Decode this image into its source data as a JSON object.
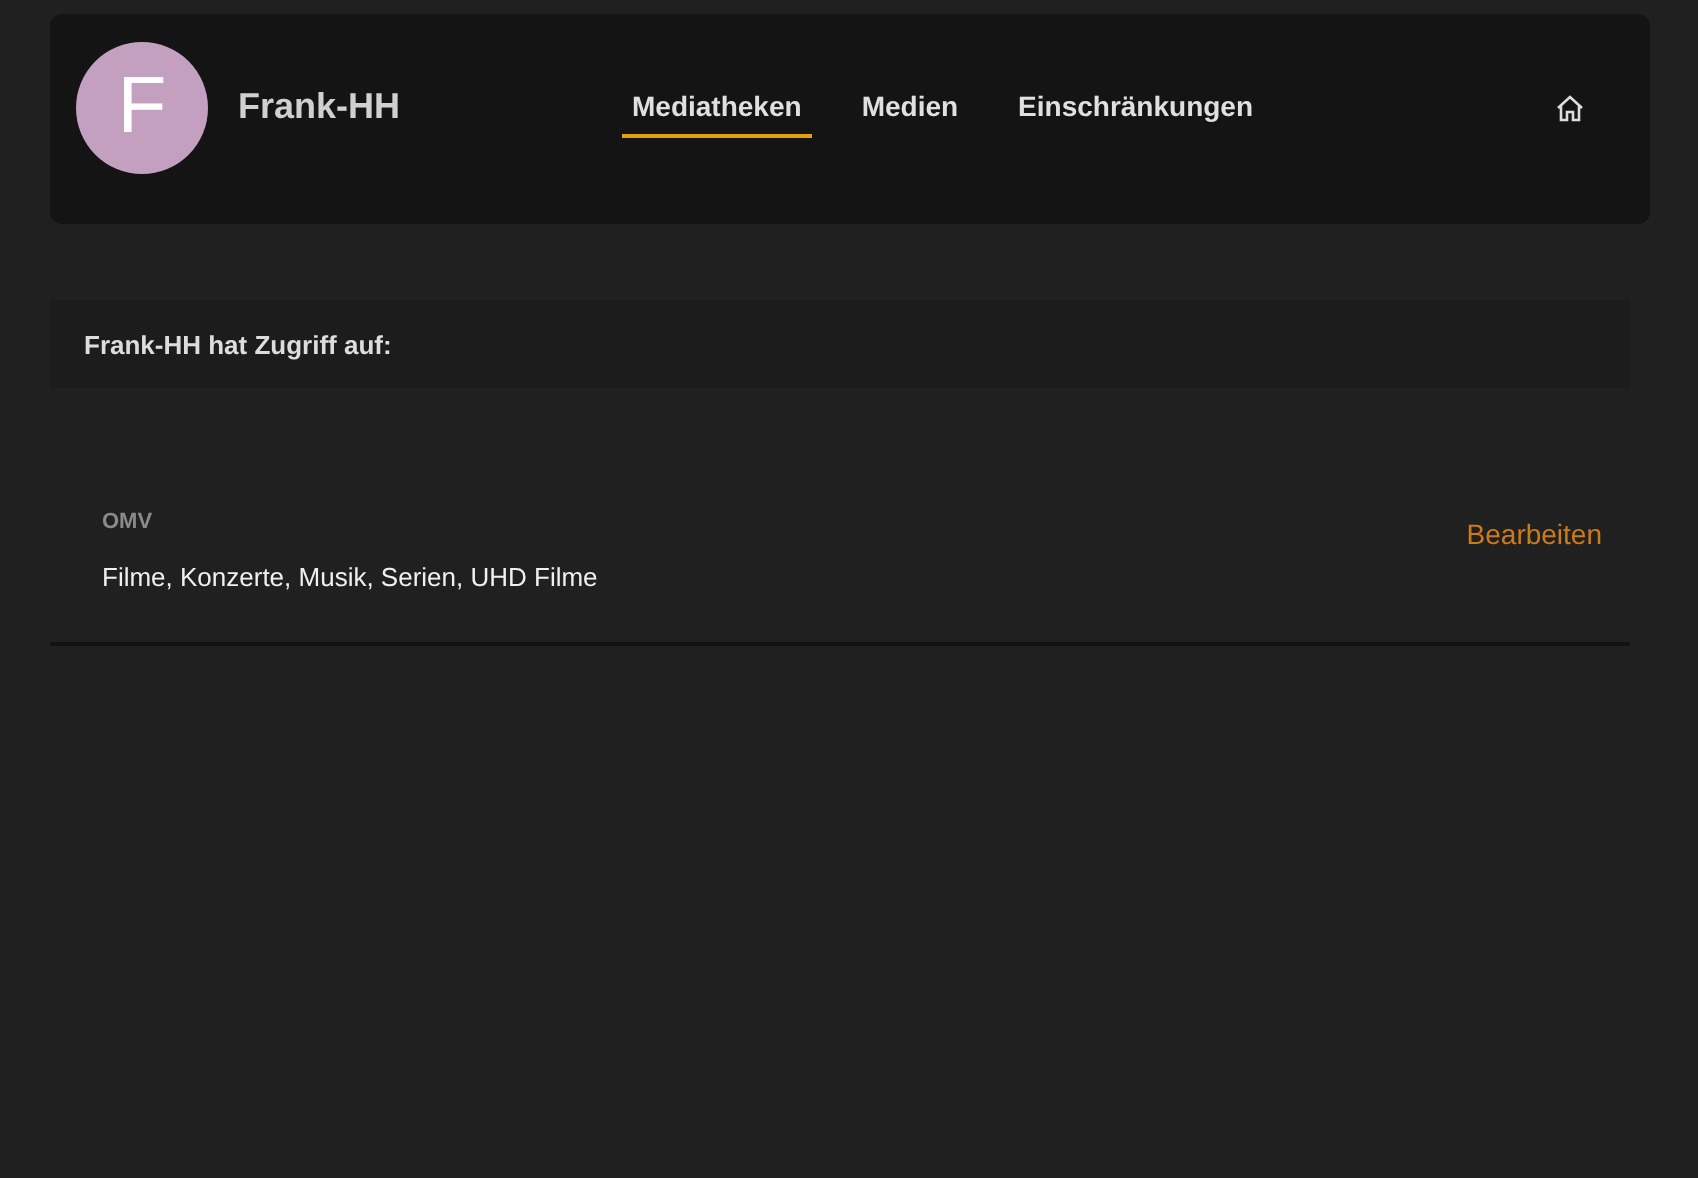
{
  "user": {
    "initial": "F",
    "name": "Frank-HH"
  },
  "tabs": [
    {
      "label": "Mediatheken",
      "selected": true
    },
    {
      "label": "Medien",
      "selected": false
    },
    {
      "label": "Einschränkungen",
      "selected": false
    }
  ],
  "section": {
    "title": "Frank-HH hat Zugriff auf:"
  },
  "servers": [
    {
      "name": "OMV",
      "libraries": "Filme, Konzerte, Musik, Serien, UHD Filme",
      "action": "Bearbeiten"
    }
  ]
}
